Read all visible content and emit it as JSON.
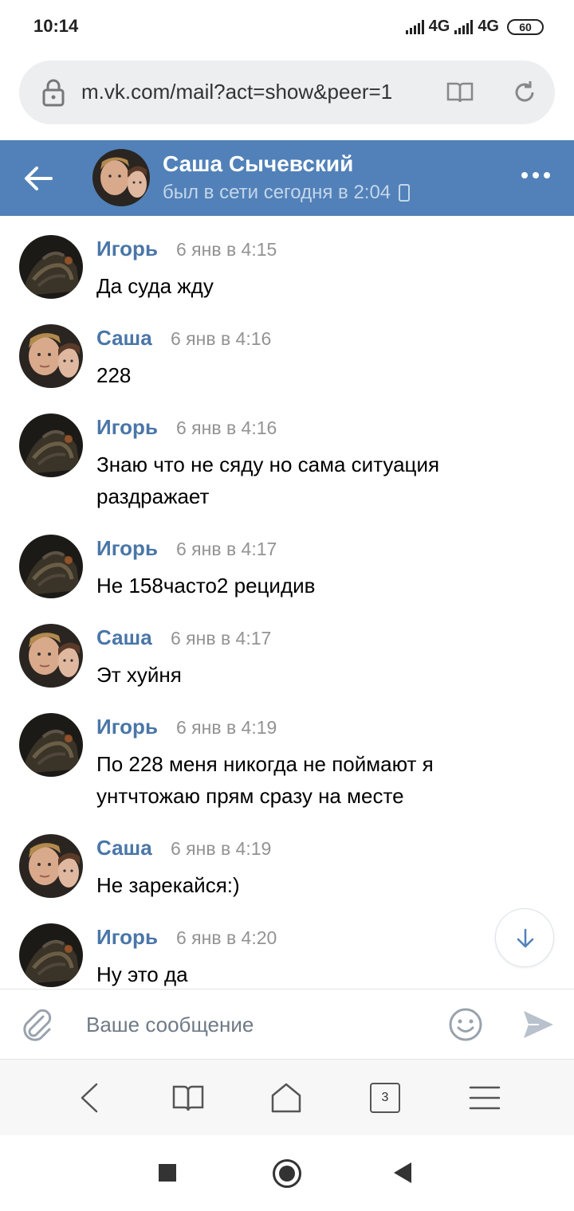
{
  "status_bar": {
    "time": "10:14",
    "network_1": "4G",
    "network_2": "4G",
    "battery": "60"
  },
  "browser": {
    "url": "m.vk.com/mail?act=show&peer=1",
    "tabs_count": "3"
  },
  "chat": {
    "contact_name": "Саша Сычевский",
    "contact_status": "был в сети сегодня в 2:04",
    "header_color": "#5181b8",
    "author_color": "#4a76a8"
  },
  "messages": [
    {
      "author": "Игорь",
      "time": "6 янв в 4:15",
      "text": "Да суда жду",
      "avatar": "igor-avatar"
    },
    {
      "author": "Саша",
      "time": "6 янв в 4:16",
      "text": "228",
      "avatar": "sasha-avatar"
    },
    {
      "author": "Игорь",
      "time": "6 янв в 4:16",
      "text": "Знаю что не сяду но сама ситуация раздражает",
      "avatar": "igor-avatar"
    },
    {
      "author": "Игорь",
      "time": "6 янв в 4:17",
      "text": "Не 158часто2 рецидив",
      "avatar": "igor-avatar"
    },
    {
      "author": "Саша",
      "time": "6 янв в 4:17",
      "text": "Эт хуйня",
      "avatar": "sasha-avatar"
    },
    {
      "author": "Игорь",
      "time": "6 янв в 4:19",
      "text": "По 228 меня никогда не поймают я унтчтожаю прям сразу на месте",
      "avatar": "igor-avatar"
    },
    {
      "author": "Саша",
      "time": "6 янв в 4:19",
      "text": "Не зарекайся:)",
      "avatar": "sasha-avatar"
    },
    {
      "author": "Игорь",
      "time": "6 янв в 4:20",
      "text": "Ну это да",
      "avatar": "igor-avatar"
    }
  ],
  "composer": {
    "placeholder": "Ваше сообщение"
  }
}
